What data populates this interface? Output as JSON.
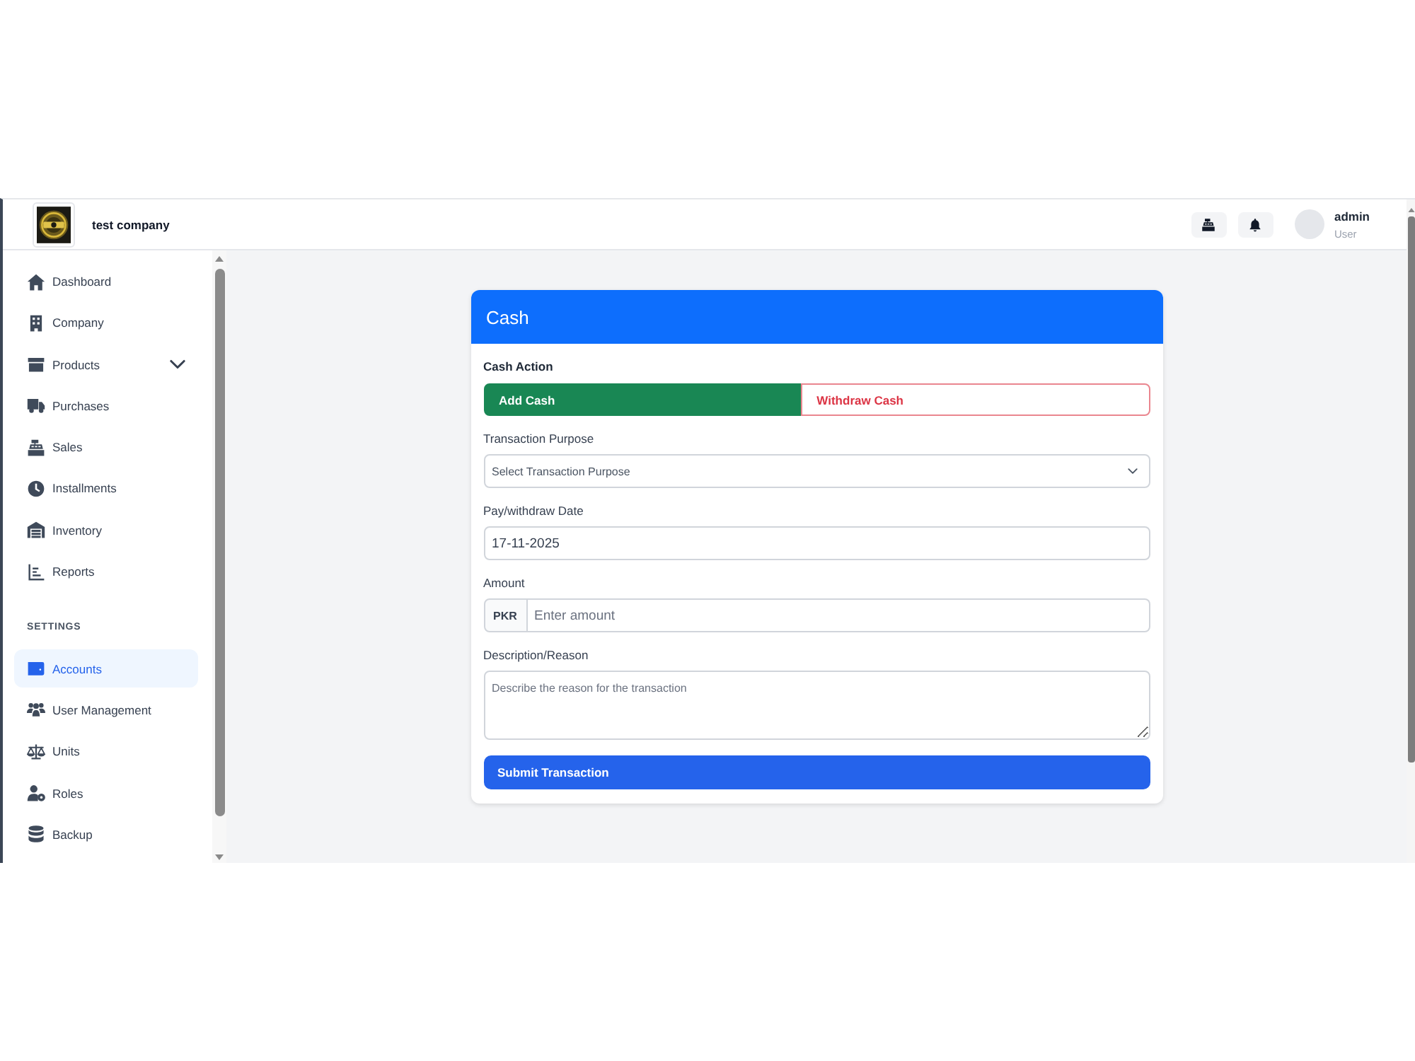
{
  "header": {
    "company_name": "test company",
    "user": {
      "name": "admin",
      "role": "User"
    }
  },
  "sidebar": {
    "items": [
      {
        "label": "Dashboard",
        "selected": false,
        "submenu": false
      },
      {
        "label": "Company",
        "selected": false,
        "submenu": false
      },
      {
        "label": "Products",
        "selected": false,
        "submenu": true
      },
      {
        "label": "Purchases",
        "selected": false,
        "submenu": false
      },
      {
        "label": "Sales",
        "selected": false,
        "submenu": false
      },
      {
        "label": "Installments",
        "selected": false,
        "submenu": false
      },
      {
        "label": "Inventory",
        "selected": false,
        "submenu": false
      },
      {
        "label": "Reports",
        "selected": false,
        "submenu": false
      }
    ],
    "settings": {
      "heading": "SETTINGS",
      "items": [
        {
          "label": "Accounts",
          "selected": true,
          "submenu": false
        },
        {
          "label": "User Management",
          "selected": false,
          "submenu": false
        },
        {
          "label": "Units",
          "selected": false,
          "submenu": false
        },
        {
          "label": "Roles",
          "selected": false,
          "submenu": false
        },
        {
          "label": "Backup",
          "selected": false,
          "submenu": false
        }
      ]
    }
  },
  "card": {
    "title": "Cash",
    "cash_action": {
      "label": "Cash Action",
      "options": [
        {
          "label": "Add Cash",
          "selected": true,
          "color": "#198754"
        },
        {
          "label": "Withdraw Cash",
          "selected": false,
          "color": "#dc3545"
        }
      ]
    },
    "fields": [
      {
        "kind": "select",
        "label": "Transaction Purpose",
        "placeholder": "Select Transaction Purpose"
      },
      {
        "kind": "date",
        "label": "Pay/withdraw Date",
        "value": "17-11-2025"
      },
      {
        "kind": "amount",
        "label": "Amount",
        "prefix": "PKR",
        "placeholder": "Enter amount"
      },
      {
        "kind": "textarea",
        "label": "Description/Reason",
        "placeholder": "Describe the reason for the transaction"
      }
    ],
    "submit": "Submit Transaction"
  }
}
